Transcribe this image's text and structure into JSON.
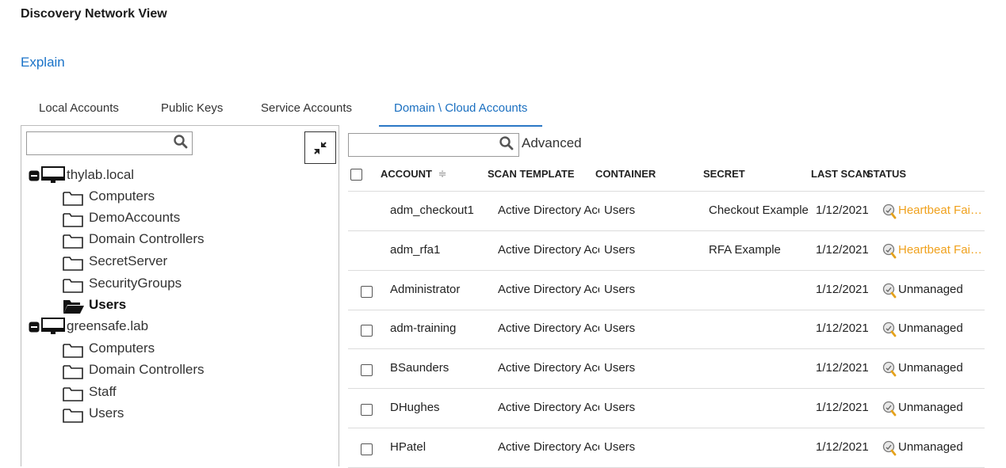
{
  "page": {
    "title": "Discovery Network View",
    "explain": "Explain"
  },
  "tabs": [
    {
      "label": "Local Accounts"
    },
    {
      "label": "Public Keys"
    },
    {
      "label": "Service Accounts"
    },
    {
      "label": "Domain \\ Cloud Accounts",
      "active": true
    }
  ],
  "tree_search": {
    "value": "",
    "icon": "search-icon"
  },
  "tree": {
    "domains": [
      {
        "label": "thylab.local",
        "children": [
          "Computers",
          "DemoAccounts",
          "Domain Controllers",
          "SecretServer",
          "SecurityGroups",
          "Users"
        ],
        "selected_child": "Users"
      },
      {
        "label": "greensafe.lab",
        "children": [
          "Computers",
          "Domain Controllers",
          "Staff",
          "Users"
        ]
      }
    ]
  },
  "grid_search": {
    "value": "",
    "advanced_label": "Advanced"
  },
  "grid": {
    "columns": [
      "ACCOUNT",
      "SCAN TEMPLATE",
      "CONTAINER",
      "SECRET",
      "LAST SCAN",
      "STATUS"
    ],
    "sort_indicator": "≑",
    "rows": [
      {
        "account": "adm_checkout1",
        "scan_template": "Active Directory Account",
        "container": "Users",
        "secret": "Checkout Example",
        "last_scan": "1/12/2021",
        "status": "Heartbeat Failed",
        "status_type": "fail",
        "checkbox": false
      },
      {
        "account": "adm_rfa1",
        "scan_template": "Active Directory Account",
        "container": "Users",
        "secret": "RFA Example",
        "last_scan": "1/12/2021",
        "status": "Heartbeat Failed",
        "status_type": "fail",
        "checkbox": false
      },
      {
        "account": "Administrator",
        "scan_template": "Active Directory Account",
        "container": "Users",
        "secret": "",
        "last_scan": "1/12/2021",
        "status": "Unmanaged",
        "status_type": "normal",
        "checkbox": true
      },
      {
        "account": "adm-training",
        "scan_template": "Active Directory Account",
        "container": "Users",
        "secret": "",
        "last_scan": "1/12/2021",
        "status": "Unmanaged",
        "status_type": "normal",
        "checkbox": true
      },
      {
        "account": "BSaunders",
        "scan_template": "Active Directory Account",
        "container": "Users",
        "secret": "",
        "last_scan": "1/12/2021",
        "status": "Unmanaged",
        "status_type": "normal",
        "checkbox": true
      },
      {
        "account": "DHughes",
        "scan_template": "Active Directory Account",
        "container": "Users",
        "secret": "",
        "last_scan": "1/12/2021",
        "status": "Unmanaged",
        "status_type": "normal",
        "checkbox": true
      },
      {
        "account": "HPatel",
        "scan_template": "Active Directory Account",
        "container": "Users",
        "secret": "",
        "last_scan": "1/12/2021",
        "status": "Unmanaged",
        "status_type": "normal",
        "checkbox": true
      }
    ]
  },
  "colors": {
    "link": "#1a73c8",
    "active_tab": "#2a77c5",
    "fail_status": "#f0a11c"
  }
}
